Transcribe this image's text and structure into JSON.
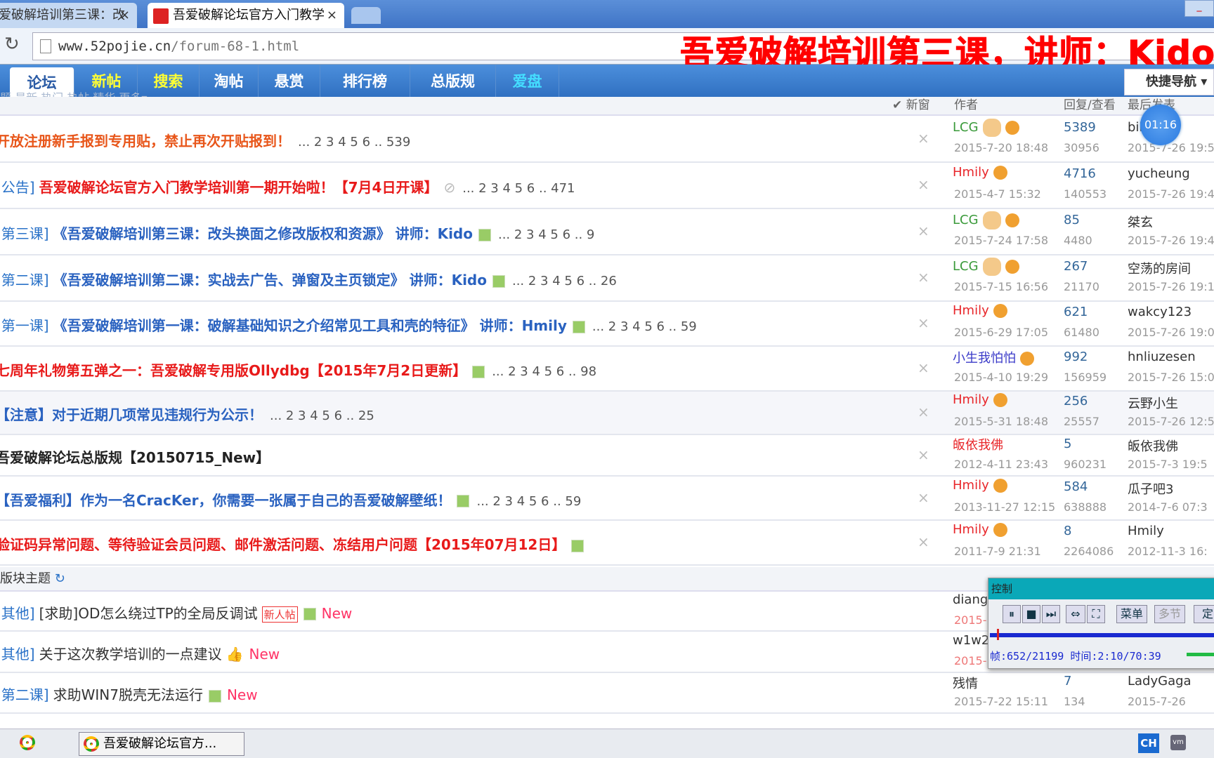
{
  "browser": {
    "tabs": [
      {
        "label": "爱破解培训第三课：改"
      },
      {
        "label": "吾爱破解论坛官方入门教学"
      }
    ],
    "url_host": "www.52pojie.cn",
    "url_path": "/forum-68-1.html"
  },
  "overlay_caption": "吾爱破解培训第三课，讲师：Kido",
  "nav": {
    "items": [
      {
        "label": "论坛",
        "color": "#2a5ba5"
      },
      {
        "label": "新帖",
        "color": "#ffff33"
      },
      {
        "label": "搜索",
        "color": "#ffff33"
      },
      {
        "label": "淘帖",
        "color": "#ffffff"
      },
      {
        "label": "悬赏",
        "color": "#ffffff"
      },
      {
        "label": "排行榜",
        "color": "#ffffff"
      },
      {
        "label": "总版规",
        "color": "#ffffff"
      },
      {
        "label": "爱盘",
        "color": "#44ddff"
      }
    ],
    "quick_nav": "快捷导航 ▾",
    "subnav": "题   最新  热门  热帖  精华  更多▾"
  },
  "table_header": {
    "new_window": "✔ 新窗",
    "author": "作者",
    "replies_views": "回复/查看",
    "last_post": "最后发表"
  },
  "timer": "01:16",
  "sticky_threads": [
    {
      "prefix": "",
      "title": "开放注册新手报到专用贴，禁止再次开贴报到！",
      "color": "#e8561a",
      "icon": "",
      "pages": "... 2 3 4 5 6 .. 539",
      "author": "LCG",
      "author_color": "#3a9a3a",
      "avatar": true,
      "date": "2015-7-20 18:48",
      "replies": "5389",
      "views": "30956",
      "last_user": "bil",
      "last_date": "2015-7-26 19:5"
    },
    {
      "prefix": "[公告]",
      "title": "吾爱破解论坛官方入门教学培训第一期开始啦！【7月4日开课】",
      "color": "#e81a1a",
      "icon": "attachment",
      "pages": "... 2 3 4 5 6 .. 471",
      "author": "Hmily",
      "author_color": "#e8262a",
      "avatar": false,
      "date": "2015-4-7 15:32",
      "replies": "4716",
      "views": "140553",
      "last_user": "yucheung",
      "last_date": "2015-7-26 19:4"
    },
    {
      "prefix": "[第三课]",
      "title": "《吾爱破解培训第三课：改头换面之修改版权和资源》 讲师：Kido",
      "color": "#2a62c0",
      "icon": "image",
      "pages": "... 2 3 4 5 6 .. 9",
      "author": "LCG",
      "author_color": "#3a9a3a",
      "avatar": true,
      "date": "2015-7-24 17:58",
      "replies": "85",
      "views": "4480",
      "last_user": "桀玄",
      "last_date": "2015-7-26 19:4"
    },
    {
      "prefix": "[第二课]",
      "title": "《吾爱破解培训第二课：实战去广告、弹窗及主页锁定》 讲师：Kido",
      "color": "#2a62c0",
      "icon": "image",
      "pages": "... 2 3 4 5 6 .. 26",
      "author": "LCG",
      "author_color": "#3a9a3a",
      "avatar": true,
      "date": "2015-7-15 16:56",
      "replies": "267",
      "views": "21170",
      "last_user": "空荡的房间",
      "last_date": "2015-7-26 19:1"
    },
    {
      "prefix": "[第一课]",
      "title": "《吾爱破解培训第一课：破解基础知识之介绍常见工具和壳的特征》 讲师：Hmily",
      "color": "#2a62c0",
      "icon": "image",
      "pages": "... 2 3 4 5 6 .. 59",
      "author": "Hmily",
      "author_color": "#e8262a",
      "avatar": false,
      "date": "2015-6-29 17:05",
      "replies": "621",
      "views": "61480",
      "last_user": "wakcy123",
      "last_date": "2015-7-26 19:0"
    },
    {
      "prefix": "",
      "title": "七周年礼物第五弹之一：吾爱破解专用版Ollydbg【2015年7月2日更新】",
      "color": "#e81a1a",
      "icon": "image",
      "pages": "... 2 3 4 5 6 .. 98",
      "author": "小生我怕怕",
      "author_color": "#3a3ac8",
      "avatar": false,
      "date": "2015-4-10 19:29",
      "replies": "992",
      "views": "156959",
      "last_user": "hnliuzesen",
      "last_date": "2015-7-26 15:0"
    },
    {
      "prefix": "",
      "title": "【注意】对于近期几项常见违规行为公示！",
      "color": "#2a62c0",
      "icon": "",
      "pages": "... 2 3 4 5 6 .. 25",
      "author": "Hmily",
      "author_color": "#e8262a",
      "avatar": false,
      "date": "2015-5-31 18:48",
      "replies": "256",
      "views": "25557",
      "last_user": "云野小生",
      "last_date": "2015-7-26 12:5",
      "shade": true
    },
    {
      "prefix": "",
      "title": "吾爱破解论坛总版规【20150715_New】",
      "color": "#222222",
      "icon": "",
      "pages": "",
      "author": "皈依我佛",
      "author_color": "#e8262a",
      "avatar": false,
      "nobadge": true,
      "date": "2012-4-11 23:43",
      "replies": "5",
      "views": "960231",
      "last_user": "皈依我佛",
      "last_date": "2015-7-3 19:5"
    },
    {
      "prefix": "",
      "title": "【吾爱福利】作为一名CracKer，你需要一张属于自己的吾爱破解壁纸！",
      "color": "#2a62c0",
      "icon": "image",
      "pages": "... 2 3 4 5 6 .. 59",
      "author": "Hmily",
      "author_color": "#e8262a",
      "avatar": false,
      "date": "2013-11-27 12:15",
      "replies": "584",
      "views": "638888",
      "last_user": "瓜子吧3",
      "last_date": "2014-7-6 07:3"
    },
    {
      "prefix": "",
      "title": "验证码异常问题、等待验证会员问题、邮件激活问题、冻结用户问题【2015年07月12日】",
      "color": "#e81a1a",
      "icon": "image",
      "pages": "",
      "author": "Hmily",
      "author_color": "#e8262a",
      "avatar": false,
      "date": "2011-7-9 21:31",
      "replies": "8",
      "views": "2264086",
      "last_user": "Hmily",
      "last_date": "2012-11-3 16:"
    }
  ],
  "section_label": "版块主题",
  "normal_threads": [
    {
      "prefix": "[其他]",
      "title": "[求助]OD怎么绕过TP的全局反调试",
      "badge": "新人帖",
      "icon": "image",
      "new": "New",
      "author": "diange",
      "date": "2015-",
      "replies": "",
      "views": "",
      "last_user": "",
      "last_date": ""
    },
    {
      "prefix": "[其他]",
      "title": "关于这次教学培训的一点建议",
      "thumb": true,
      "new": "New",
      "author": "w1w2",
      "date": "2015-",
      "replies": "",
      "views": "",
      "last_user": "",
      "last_date": ""
    },
    {
      "prefix": "[第二课]",
      "title": "求助WIN7脱壳无法运行",
      "icon": "image",
      "new": "New",
      "author": "残情",
      "date": "2015-7-22 15:11",
      "replies": "7",
      "views": "134",
      "last_user": "LadyGaga",
      "last_date": "2015-7-26"
    }
  ],
  "player": {
    "title": "控制",
    "buttons": [
      "菜单",
      "多节",
      "定"
    ],
    "status": "帧:652/21199 时间:2:10/70:39",
    "progress_fraction": 0.031
  },
  "taskbar": {
    "task": "吾爱破解论坛官方...",
    "ime": "CH",
    "tray": "vm"
  }
}
